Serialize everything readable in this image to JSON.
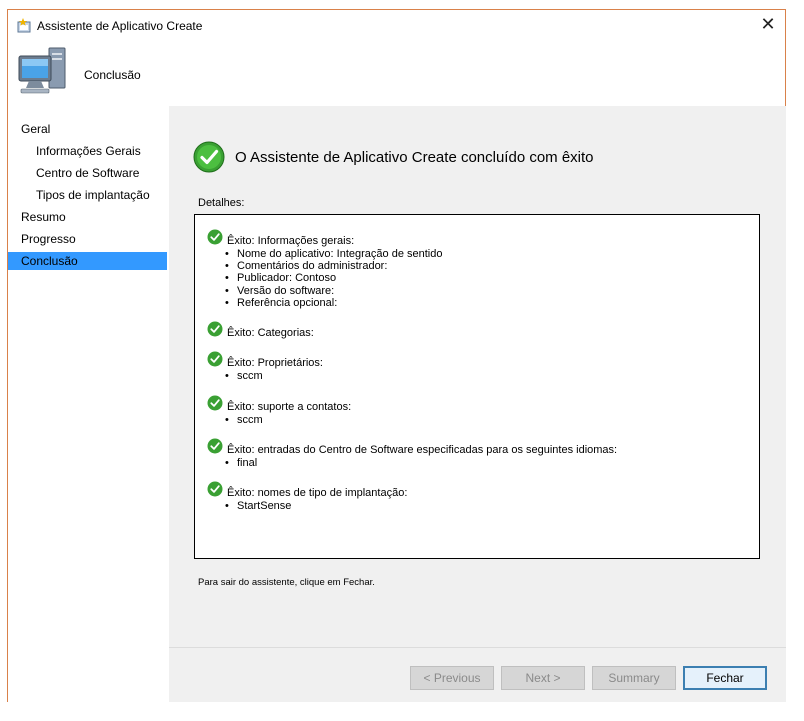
{
  "window": {
    "title": "Assistente de Aplicativo Create",
    "close_glyph": "✕"
  },
  "header": {
    "title": "Conclusão",
    "icon": "computer-icon"
  },
  "nav": {
    "items": [
      {
        "label": "Geral",
        "level": 0,
        "active": false
      },
      {
        "label": "Informações Gerais",
        "level": 1,
        "active": false
      },
      {
        "label": "Centro de Software",
        "level": 1,
        "active": false
      },
      {
        "label": "Tipos de implantação",
        "level": 1,
        "active": false
      },
      {
        "label": "Resumo",
        "level": 0,
        "active": false
      },
      {
        "label": "Progresso",
        "level": 0,
        "active": false
      },
      {
        "label": "Conclusão",
        "level": 0,
        "active": true
      }
    ]
  },
  "main": {
    "headline": "O Assistente de Aplicativo Create concluído com êxito",
    "details_label": "Detalhes:",
    "details": [
      {
        "title": "Êxito: Informações gerais:",
        "items": [
          "Nome do aplicativo: Integração de sentido",
          "Comentários do administrador:",
          "Publicador: Contoso",
          "Versão do software:",
          "Referência opcional:"
        ]
      },
      {
        "title": "Êxito: Categorias:",
        "items": []
      },
      {
        "title": "Êxito: Proprietários:",
        "items": [
          "sccm"
        ]
      },
      {
        "title": "Êxito: suporte a contatos:",
        "items": [
          "sccm"
        ]
      },
      {
        "title": "Êxito: entradas do Centro de Software especificadas para os seguintes idiomas:",
        "items": [
          "final"
        ]
      },
      {
        "title": "Êxito: nomes de tipo de implantação:",
        "items": [
          "StartSense"
        ]
      }
    ],
    "exit_hint": "Para sair do assistente, clique em Fechar."
  },
  "buttons": {
    "previous": "< Previous",
    "next": "Next >",
    "summary": "Summary",
    "close": "Fechar"
  },
  "colors": {
    "active_nav": "#3399ff",
    "window_border": "#d9814a",
    "success_green": "#3aa033"
  }
}
